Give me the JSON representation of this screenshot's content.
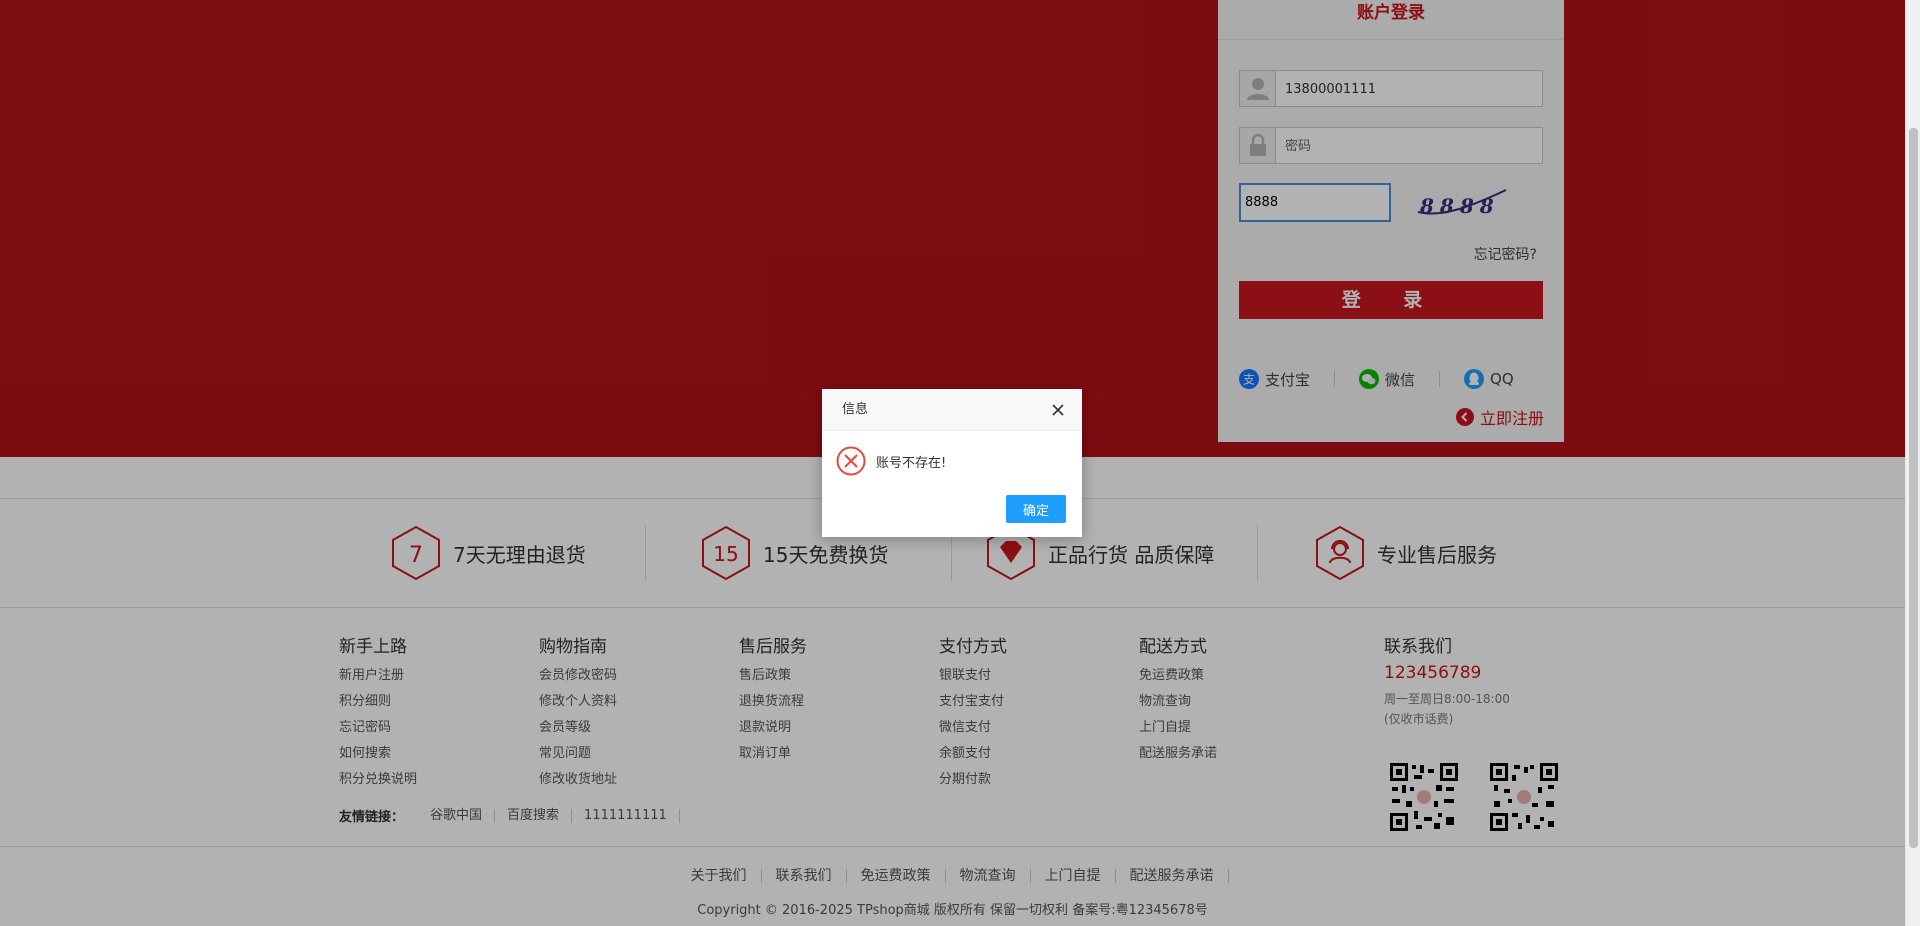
{
  "login": {
    "title": "账户登录",
    "username_value": "13800001111",
    "password_placeholder": "密码",
    "captcha_value": "8888",
    "captcha_text": "8888",
    "forgot_label": "忘记密码?",
    "submit_label": "登 录",
    "oauth": [
      {
        "label": "支付宝",
        "icon": "alipay-icon",
        "color": "#1677ff"
      },
      {
        "label": "微信",
        "icon": "wechat-icon",
        "color": "#09bb07"
      },
      {
        "label": "QQ",
        "icon": "qq-icon",
        "color": "#1e9fff"
      }
    ],
    "register_label": "立即注册"
  },
  "services": [
    {
      "badge": "7",
      "label": "7天无理由退货"
    },
    {
      "badge": "15",
      "label": "15天免费换货"
    },
    {
      "badge": "diamond",
      "label": "正品行货 品质保障"
    },
    {
      "badge": "person",
      "label": "专业售后服务"
    }
  ],
  "footer": {
    "columns": [
      {
        "title": "新手上路",
        "links": [
          "新用户注册",
          "积分细则",
          "忘记密码",
          "如何搜索",
          "积分兑换说明"
        ]
      },
      {
        "title": "购物指南",
        "links": [
          "会员修改密码",
          "修改个人资料",
          "会员等级",
          "常见问题",
          "修改收货地址"
        ]
      },
      {
        "title": "售后服务",
        "links": [
          "售后政策",
          "退换货流程",
          "退款说明",
          "取消订单"
        ]
      },
      {
        "title": "支付方式",
        "links": [
          "银联支付",
          "支付宝支付",
          "微信支付",
          "余额支付",
          "分期付款"
        ]
      },
      {
        "title": "配送方式",
        "links": [
          "免运费政策",
          "物流查询",
          "上门自提",
          "配送服务承诺"
        ]
      }
    ],
    "contact": {
      "title": "联系我们",
      "phone": "123456789",
      "hours": "周一至周日8:00-18:00",
      "hours_note": "(仅收市话费)"
    },
    "friend_links_label": "友情链接：",
    "friend_links": [
      "谷歌中国",
      "百度搜索",
      "1111111111"
    ],
    "bottom_nav": [
      "关于我们",
      "联系我们",
      "免运费政策",
      "物流查询",
      "上门自提",
      "配送服务承诺"
    ],
    "copyright": "Copyright © 2016-2025 TPshop商城 版权所有 保留一切权利 备案号:粤12345678号"
  },
  "dialog": {
    "title": "信息",
    "message": "账号不存在!",
    "ok_label": "确定"
  },
  "colors": {
    "brand_red": "#c8161d",
    "dialog_button": "#1e9fff"
  }
}
